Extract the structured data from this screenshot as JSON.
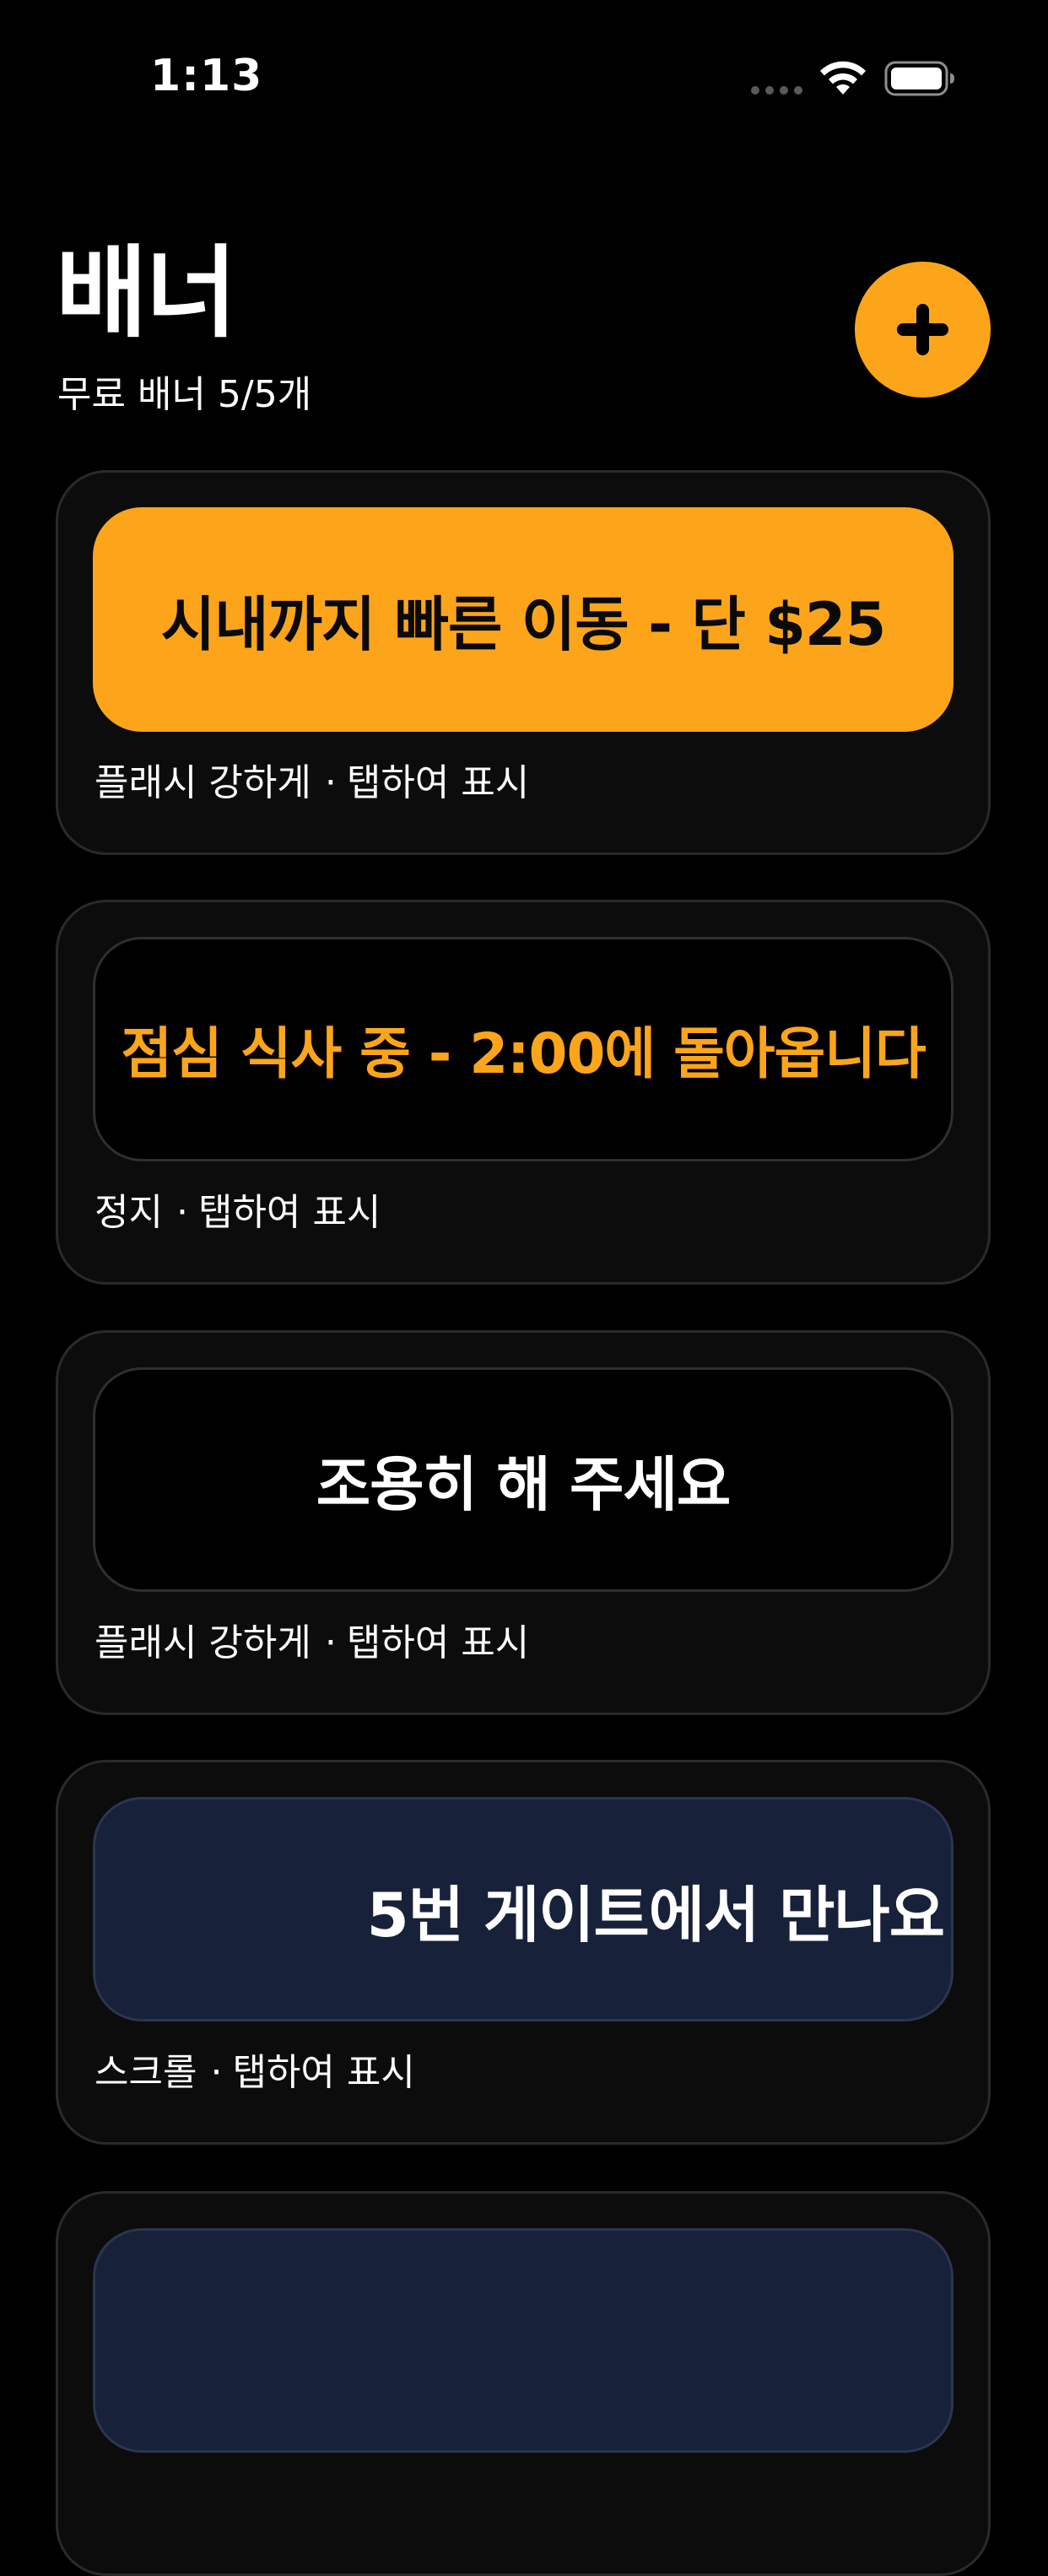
{
  "status_bar": {
    "time": "1:13",
    "icons": [
      "cellular-signal-icon",
      "wifi-icon",
      "battery-icon"
    ]
  },
  "header": {
    "title": "배너",
    "subtitle": "무료 배너 5/5개",
    "add_button_icon": "plus-icon"
  },
  "colors": {
    "accent": "#FDA51A",
    "background": "#000000",
    "card": "#0c0c0c",
    "navy": "#18213a"
  },
  "separator": "·",
  "banners": [
    {
      "text": "시내까지 빠른 이동 - 단 $25",
      "effect": "플래시 강하게",
      "action": "탭하여 표시",
      "style": "orange"
    },
    {
      "text": "점심 식사 중 - 2:00에 돌아옵니다",
      "effect": "정지",
      "action": "탭하여 표시",
      "style": "black-orange-text"
    },
    {
      "text": "조용히 해 주세요",
      "effect": "플래시 강하게",
      "action": "탭하여 표시",
      "style": "black-white-text"
    },
    {
      "text": "5번 게이트에서 만나요",
      "effect": "스크롤",
      "action": "탭하여 표시",
      "style": "navy-scroll"
    },
    {
      "text": "",
      "effect": "",
      "action": "",
      "style": "navy"
    }
  ]
}
